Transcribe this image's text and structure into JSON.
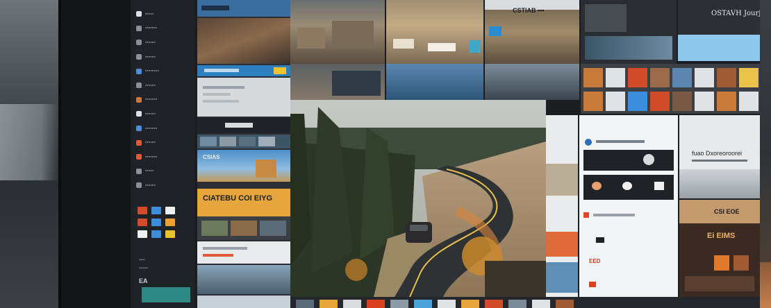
{
  "sidebar": {
    "items": [
      {
        "label": "▪▪▪▪▪",
        "color": "#e0e3e6"
      },
      {
        "label": "▪▪▪▪▪▪▪",
        "color": "#8c9196"
      },
      {
        "label": "▪▪▪▪▪▪",
        "color": "#8c9196"
      },
      {
        "label": "▪▪▪▪▪▪",
        "color": "#8c9196"
      },
      {
        "label": "▪▪▪▪▪▪▪▪",
        "color": "#4c8fd6"
      },
      {
        "label": "▪▪▪▪▪▪",
        "color": "#8c9196"
      },
      {
        "label": "▪▪▪▪▪▪▪",
        "color": "#c7793c"
      },
      {
        "label": "▪▪▪▪▪▪",
        "color": "#e0e3e6"
      },
      {
        "label": "▪▪▪▪▪▪▪",
        "color": "#4c8fd6"
      },
      {
        "label": "▪▪▪▪▪▪",
        "color": "#e05a3a"
      },
      {
        "label": "▪▪▪▪▪▪▪",
        "color": "#e05a3a"
      },
      {
        "label": "▪▪▪▪▪",
        "color": "#8c9196"
      },
      {
        "label": "▪▪▪▪▪▪",
        "color": "#8c9196"
      }
    ],
    "app_tiles": [
      "#d24b2a",
      "#3c8ddc",
      "#f0f0f0",
      "#d24b2a",
      "#3c8ddc",
      "#f0a030",
      "#f0f0f0",
      "#3c8ddc",
      "#e9c12a"
    ],
    "footer_logo": "EA"
  },
  "tiles": {
    "promo_banner_title": "CIATEBU  COI EIYG",
    "left_blue_card_title": "CSIAS",
    "top_right_title": "CSTIAB ▪▪▪",
    "brand_title": "OSTAVH Jourj",
    "right_article_title": "fuao Dxoreoroorei",
    "right_grid_title": "CSI EOE",
    "right_grid_sub": "Ei EIMS",
    "red_text": "EED"
  },
  "colors": {
    "accent_blue": "#4aa3d9",
    "accent_orange": "#e7a63b",
    "accent_red": "#d9411f",
    "teal": "#2f8a86"
  }
}
